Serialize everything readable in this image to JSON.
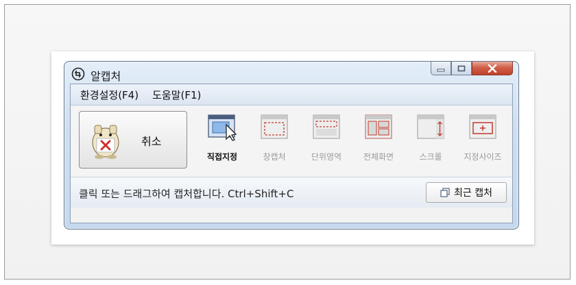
{
  "window": {
    "title": "알캡처"
  },
  "title_buttons": {
    "minimize_icon": "minimize-icon",
    "maximize_icon": "maximize-icon",
    "close_icon": "close-icon"
  },
  "menu": [
    {
      "label": "환경설정(F4)"
    },
    {
      "label": "도움말(F1)"
    }
  ],
  "cancel_button": {
    "label": "취소",
    "icon": "cancel-mascot-icon"
  },
  "tools": [
    {
      "label": "직접지정",
      "active": true,
      "icon": "direct-select-icon"
    },
    {
      "label": "창캡처",
      "active": false,
      "icon": "window-capture-icon"
    },
    {
      "label": "단위영역",
      "active": false,
      "icon": "unit-area-icon"
    },
    {
      "label": "전체화면",
      "active": false,
      "icon": "fullscreen-icon"
    },
    {
      "label": "스크롤",
      "active": false,
      "icon": "scroll-icon"
    },
    {
      "label": "지정사이즈",
      "active": false,
      "icon": "fixed-size-icon"
    }
  ],
  "status": {
    "text": "클릭 또는 드래그하여 캡처합니다. Ctrl+Shift+C",
    "recent_button": "최근 캡처"
  },
  "colors": {
    "title_bar": "#d4e3f4",
    "close_button": "#c94f38",
    "active_label": "#111111",
    "inactive_label": "#9a9a9a",
    "icon_accent": "#c0392b"
  }
}
